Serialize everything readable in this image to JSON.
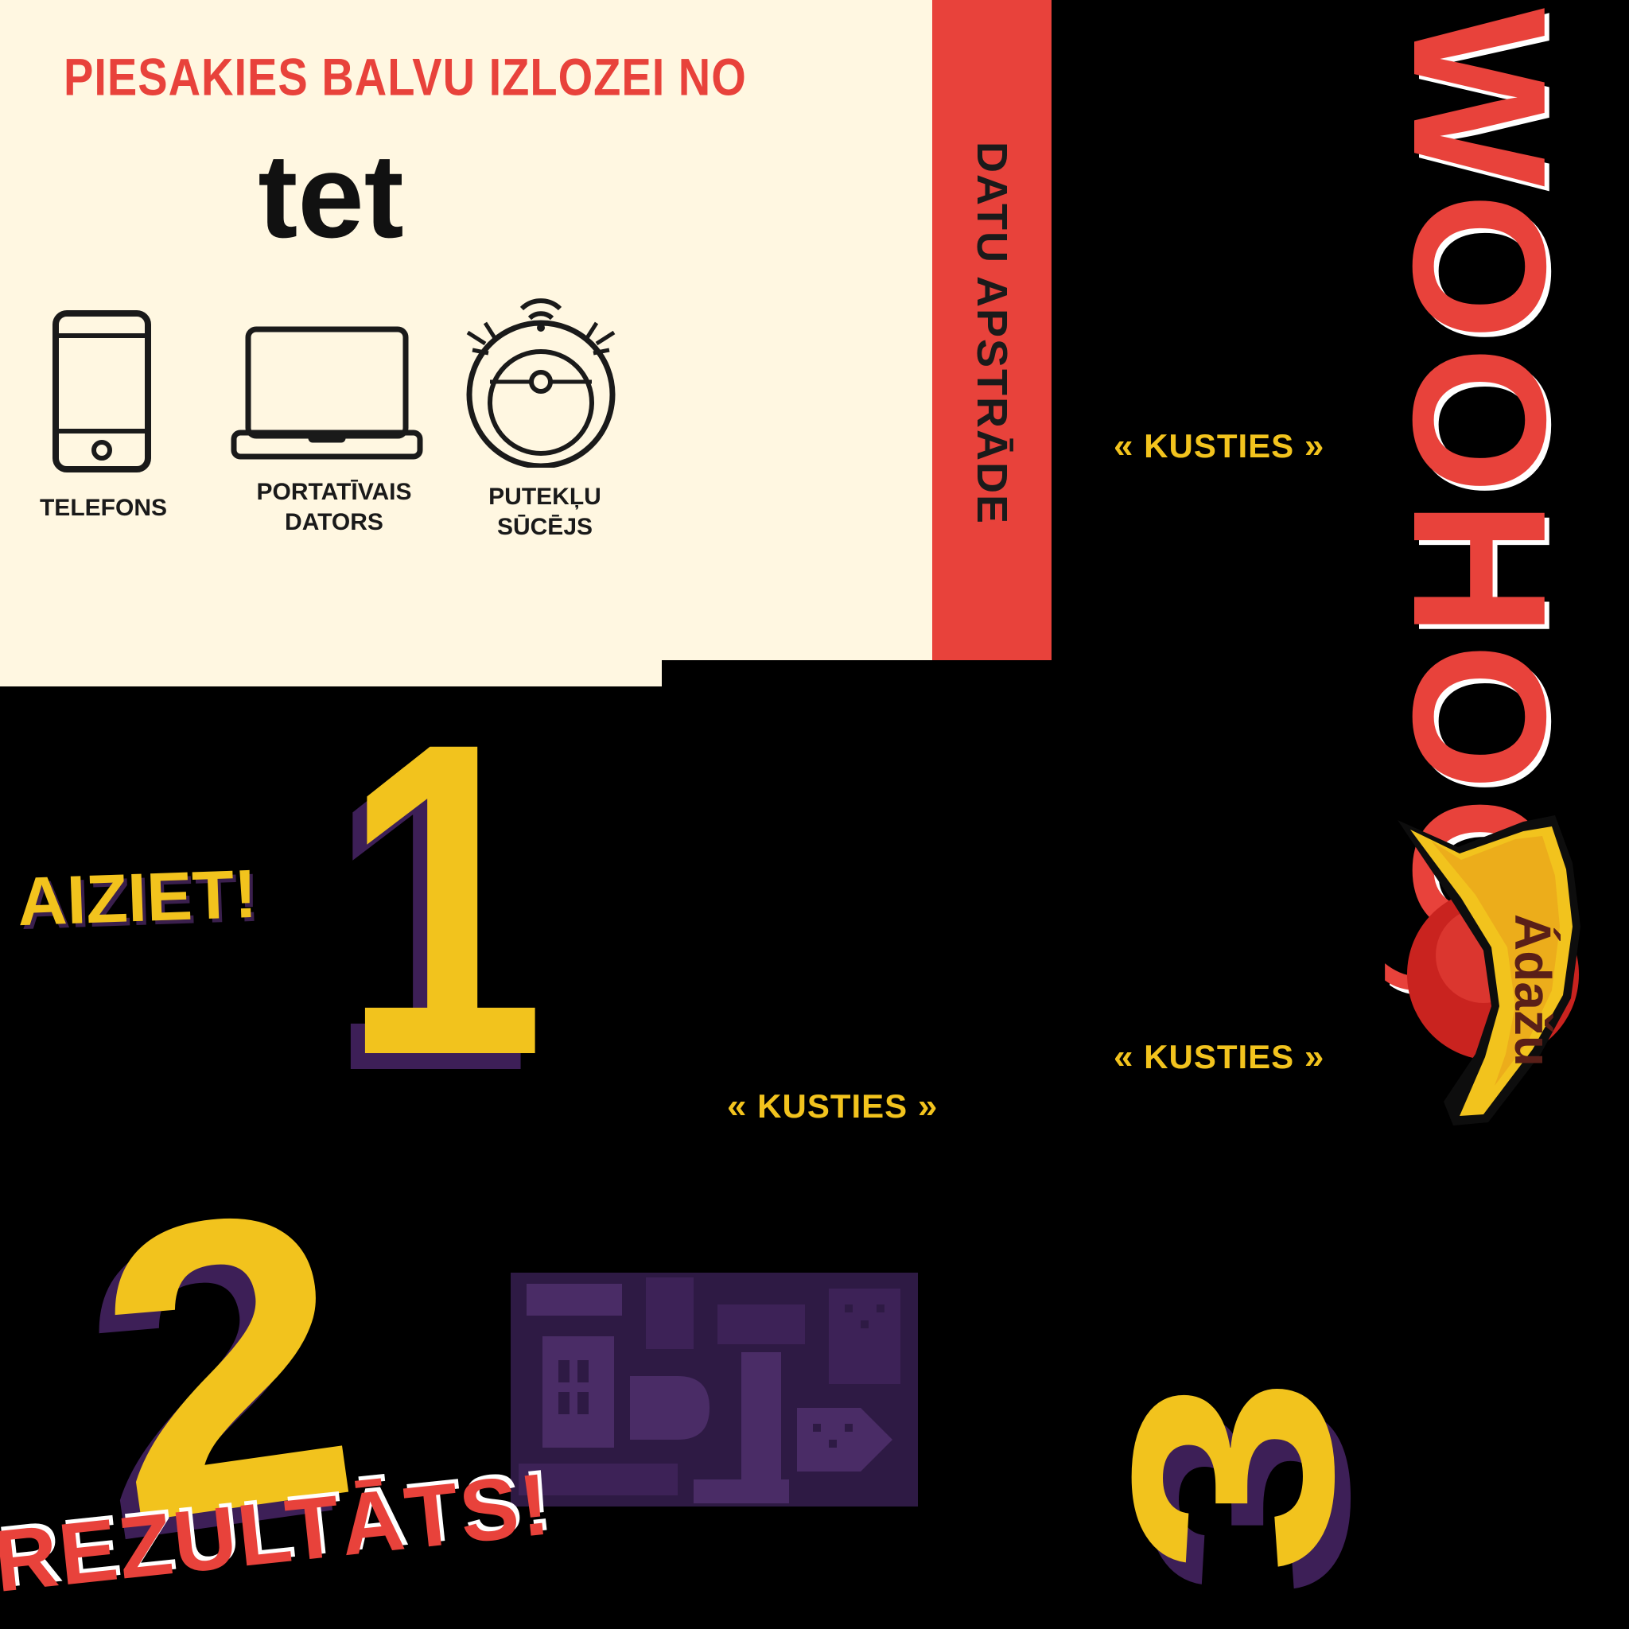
{
  "prize_panel": {
    "heading": "PIESAKIES BALVU IZLOZEI NO",
    "brand": "tet",
    "items": [
      {
        "icon": "phone-icon",
        "label_line1": "TELEFONS",
        "label_line2": ""
      },
      {
        "icon": "laptop-icon",
        "label_line1": "PORTATĪVAIS",
        "label_line2": "DATORS"
      },
      {
        "icon": "robot-vacuum-icon",
        "label_line1": "PUTEKĻU",
        "label_line2": "SŪCĒJS"
      }
    ]
  },
  "data_strip": {
    "label": "DATU APSTRĀDE"
  },
  "woohoo": "WOOHOO,",
  "kusties_label": "KUSTIES",
  "brand_logo": {
    "name": "Ádažu"
  },
  "go_text": "AIZIET!",
  "numbers": {
    "one": "1",
    "two": "2",
    "three": "3"
  },
  "result_text": "REZULTĀTS!",
  "colors": {
    "cream": "#fff7e1",
    "red": "#e8423b",
    "yellow": "#f2c31d",
    "purple": "#3d1f57",
    "black": "#000000"
  }
}
